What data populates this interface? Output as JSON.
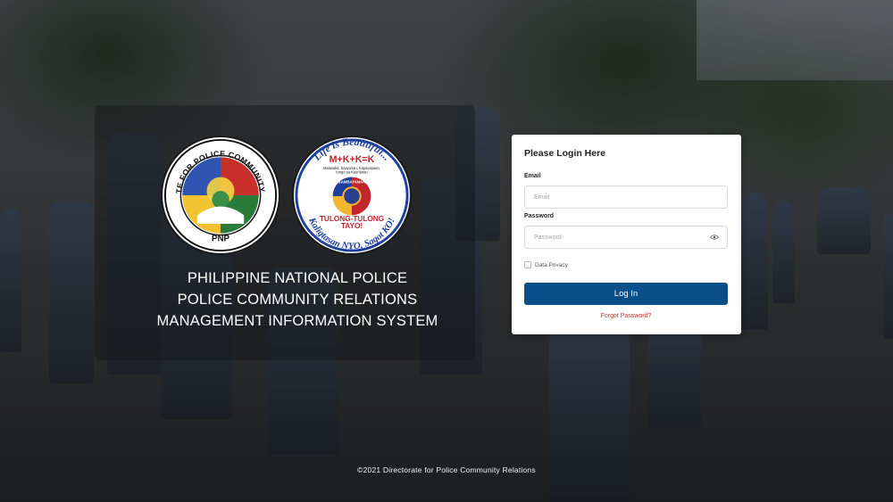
{
  "brand": {
    "left_logo": {
      "ring_text": "DIRECTORATE FOR POLICE COMMUNITY RELATIONS",
      "bottom_text": "PNP"
    },
    "right_logo": {
      "top_text": "Life is Beautiful...",
      "formula": "M+K+K=K",
      "small_text_1": "Malasakit, Kaayusan, Kapayapaan,",
      "small_text_2": "tungo sa Kaunlaran",
      "center_top": "SAMBAYANAN",
      "slogan_1": "TULONG-TULONG",
      "slogan_2": "TAYO!",
      "bottom_text": "Kaligtasan NYO, Sagot KO!"
    },
    "title_lines": [
      "PHILIPPINE NATIONAL POLICE",
      "POLICE COMMUNITY RELATIONS",
      "MANAGEMENT INFORMATION SYSTEM"
    ]
  },
  "login": {
    "heading": "Please Login Here",
    "email_label": "Email",
    "email_placeholder": "Email",
    "email_value": "",
    "password_label": "Password",
    "password_placeholder": "Password",
    "password_value": "",
    "privacy_label": "Data Privacy",
    "privacy_checked": false,
    "submit_label": "Log In",
    "forgot_label": "Forgot Password?"
  },
  "footer": {
    "copyright": "©2021 Directorate for Police Community Relations"
  },
  "colors": {
    "primary_button": "#0b4f8a",
    "link": "#c0392b",
    "card_bg": "#ffffff"
  },
  "icons": {
    "password_toggle": "eye-icon"
  }
}
